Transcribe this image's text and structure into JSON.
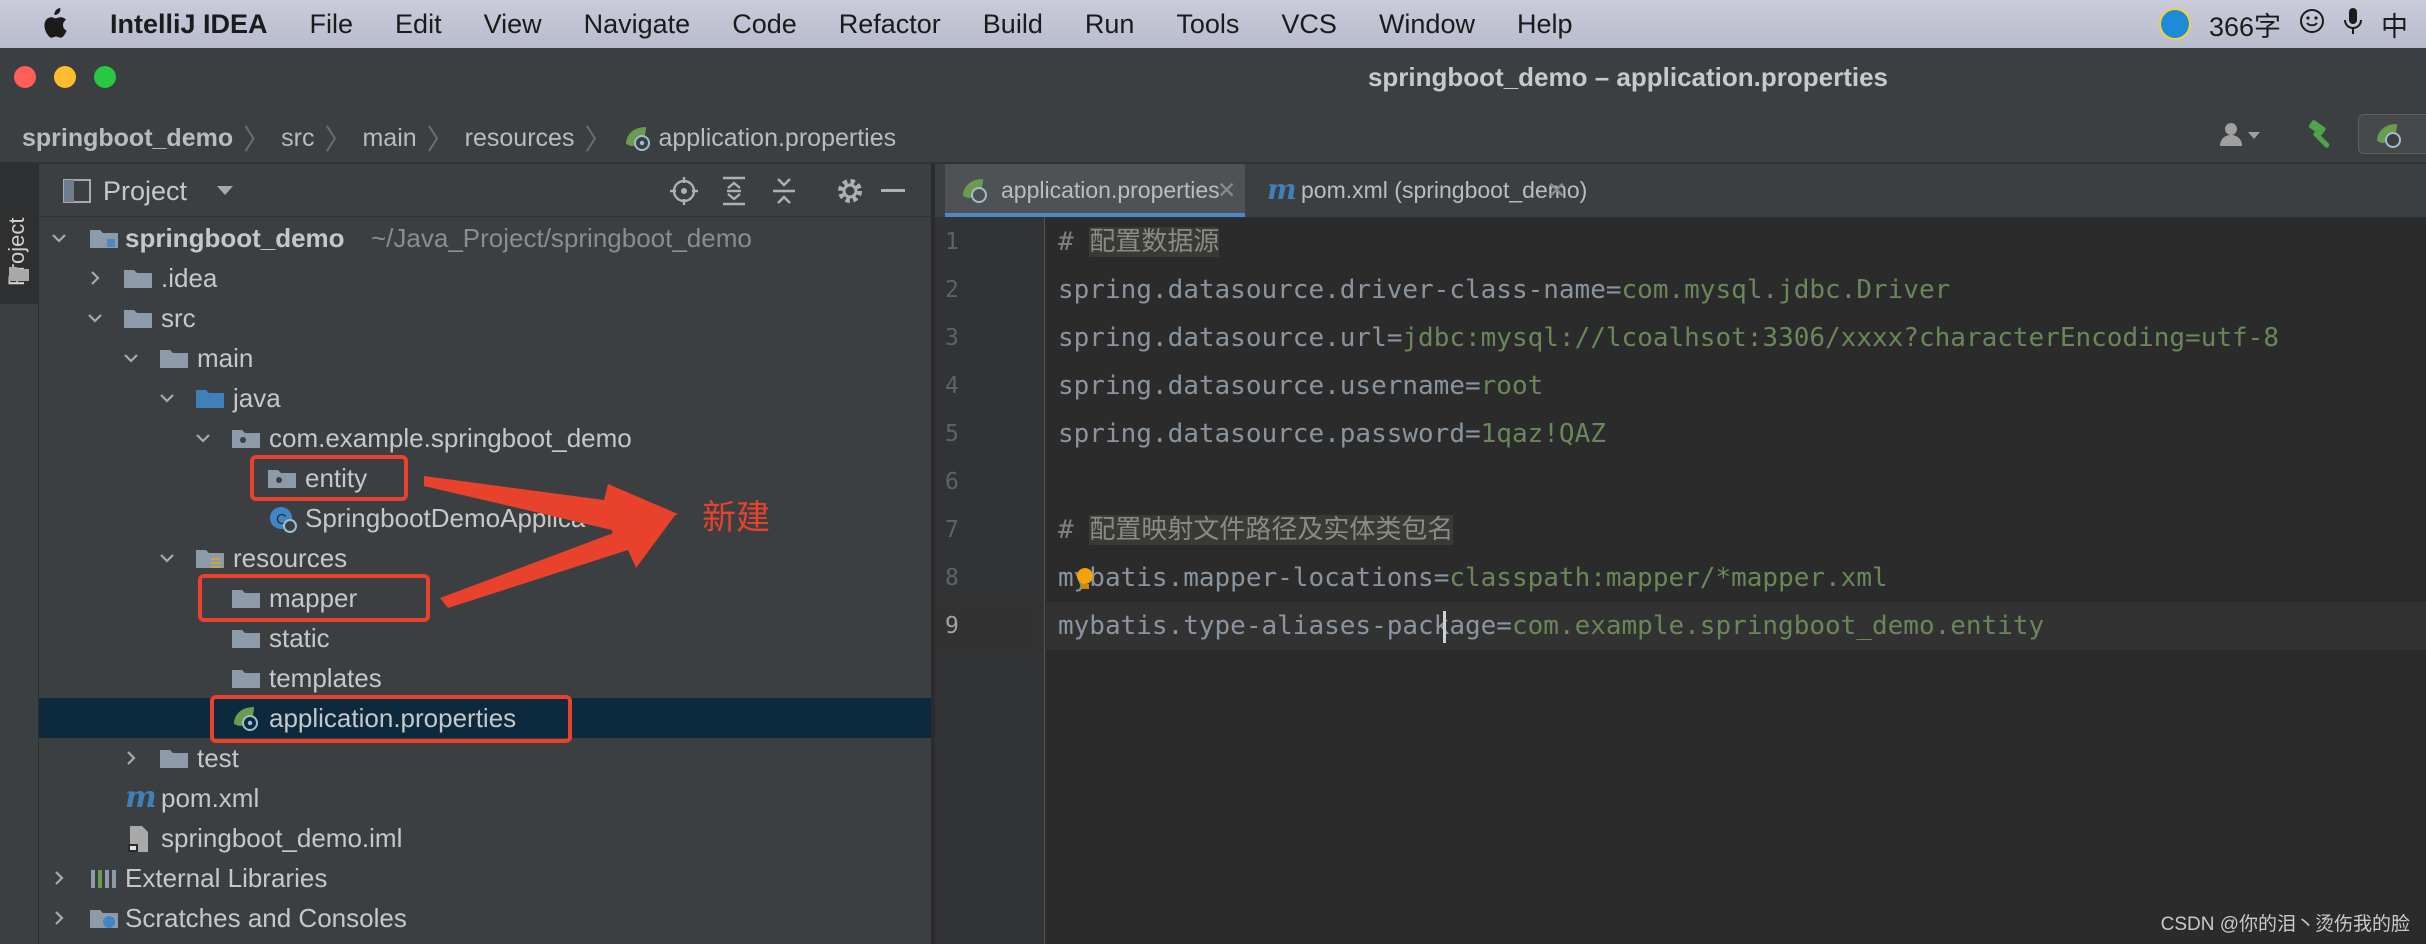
{
  "menubar": {
    "app": "IntelliJ IDEA",
    "items": [
      "File",
      "Edit",
      "View",
      "Navigate",
      "Code",
      "Refactor",
      "Build",
      "Run",
      "Tools",
      "VCS",
      "Window",
      "Help"
    ],
    "tray_word_count": "366字",
    "tray_input": "中"
  },
  "window": {
    "title": "springboot_demo – application.properties"
  },
  "breadcrumb": [
    "springboot_demo",
    "src",
    "main",
    "resources",
    "application.properties"
  ],
  "left_strip": {
    "tab": "Project"
  },
  "project_panel": {
    "title": "Project",
    "root": {
      "name": "springboot_demo",
      "path": "~/Java_Project/springboot_demo"
    },
    "tree": [
      {
        "label": ".idea"
      },
      {
        "label": "src"
      },
      {
        "label": "main"
      },
      {
        "label": "java"
      },
      {
        "label": "com.example.springboot_demo"
      },
      {
        "label": "entity"
      },
      {
        "label": "SpringbootDemoApplica"
      },
      {
        "label": "resources"
      },
      {
        "label": "mapper"
      },
      {
        "label": "static"
      },
      {
        "label": "templates"
      },
      {
        "label": "application.properties"
      },
      {
        "label": "test"
      },
      {
        "label": "pom.xml"
      },
      {
        "label": "springboot_demo.iml"
      },
      {
        "label": "External Libraries"
      },
      {
        "label": "Scratches and Consoles"
      }
    ]
  },
  "editor": {
    "tabs": [
      {
        "label": "application.properties",
        "active": true
      },
      {
        "label": "pom.xml (springboot_demo)",
        "active": false
      }
    ],
    "line_numbers": [
      "1",
      "2",
      "3",
      "4",
      "5",
      "6",
      "7",
      "8",
      "9"
    ],
    "lines": [
      {
        "comment": "# ",
        "comment_text": "配置数据源"
      },
      {
        "key": "spring.datasource.driver-class-name",
        "value": "com.mysql.jdbc.Driver"
      },
      {
        "key": "spring.datasource.url",
        "value": "jdbc:mysql://lcoalhsot:3306/xxxx?characterEncoding=utf-8"
      },
      {
        "key": "spring.datasource.username",
        "value": "root"
      },
      {
        "key": "spring.datasource.password",
        "value": "1qaz!QAZ"
      },
      {},
      {
        "comment": "# ",
        "comment_text": "配置映射文件路径及实体类包名"
      },
      {
        "key": "mybatis.mapper-locations",
        "value": "classpath:mapper/*mapper.xml"
      },
      {
        "key": "mybatis.type-aliases-package",
        "value": "com.example.springboot_demo.entity"
      }
    ]
  },
  "annotation": {
    "text": "新建",
    "color": "#e8412c"
  },
  "watermark": "CSDN @你的泪丶烫伤我的脸"
}
